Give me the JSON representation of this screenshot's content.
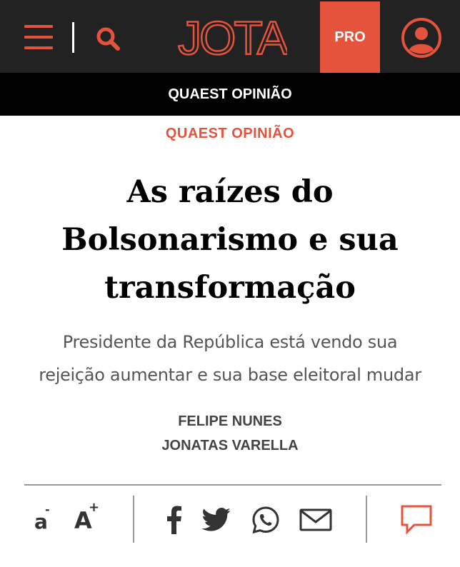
{
  "header": {
    "logo_text": "JOTA",
    "pro_label": "PRO",
    "icons": [
      "menu-icon",
      "search-icon",
      "user-icon"
    ],
    "accent_color": "#e5533d",
    "background_color": "#222222"
  },
  "section_bar": {
    "label": "QUAEST OPINIÃO"
  },
  "article": {
    "kicker": "QUAEST OPINIÃO",
    "title_lines": [
      "As raízes do",
      "Bolsonarismo e sua",
      "transformação"
    ],
    "subtitle_lines": [
      "Presidente da República está vendo sua",
      "rejeição aumentar e sua base eleitoral mudar"
    ],
    "authors": [
      "FELIPE NUNES",
      "JONATAS VARELLA"
    ]
  },
  "toolbar": {
    "font_decrease_label": "a",
    "font_decrease_sign": "-",
    "font_increase_label": "A",
    "font_increase_sign": "+",
    "share_icons": [
      "facebook-icon",
      "twitter-icon",
      "whatsapp-icon",
      "email-icon"
    ],
    "comment_icon": "comment-icon"
  }
}
